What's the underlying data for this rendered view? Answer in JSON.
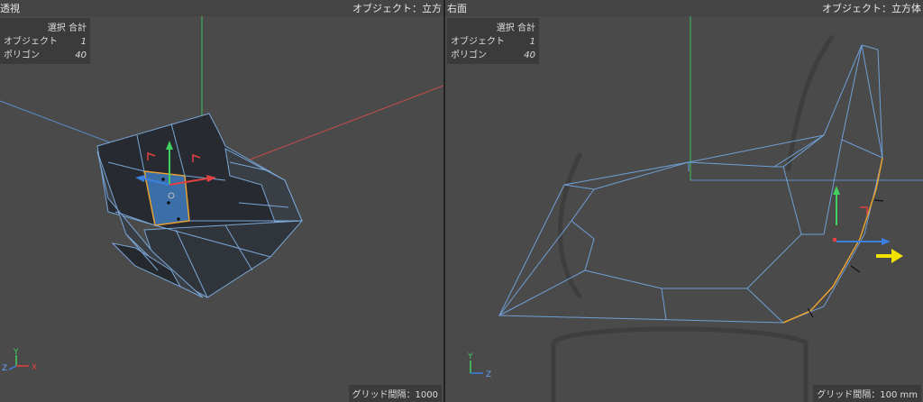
{
  "left_viewport": {
    "title": "透視",
    "object_label": "オブジェクト：立方",
    "stats": {
      "header": "選択 合計",
      "rows": [
        {
          "label": "オブジェクト",
          "value": "1"
        },
        {
          "label": "ポリゴン",
          "value": "40"
        }
      ]
    },
    "grid_spacing": "グリッド間隔：1000",
    "axes": {
      "y": "Y",
      "z": "Z",
      "x": "X"
    }
  },
  "right_viewport": {
    "title": "右面",
    "object_label": "オブジェクト：立方体",
    "stats": {
      "header": "選択 合計",
      "rows": [
        {
          "label": "オブジェクト",
          "value": "1"
        },
        {
          "label": "ポリゴン",
          "value": "40"
        }
      ]
    },
    "grid_spacing": "グリッド間隔：100 mm",
    "axes": {
      "y": "Y",
      "z": "Z"
    }
  },
  "colors": {
    "viewport_bg": "#4a4a4a",
    "mesh_edge": "#6f9fd4",
    "selected_edge": "#e8a030",
    "selected_face": "#3c6fa8",
    "axis_x": "#e04040",
    "axis_y": "#40d060",
    "axis_z": "#3a80e0",
    "arrow": "#f2e200"
  }
}
